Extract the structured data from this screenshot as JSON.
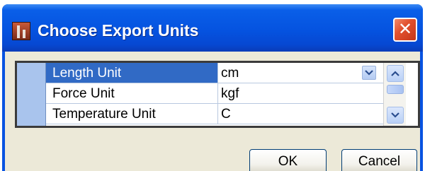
{
  "window": {
    "title": "Choose Export Units",
    "app_icon": "app-logo-icon",
    "close_icon": "close-icon",
    "close_symbol": "✕",
    "colors": {
      "titlebar": "#0553e0",
      "close": "#e2512e",
      "client": "#ece9d8",
      "selection": "#316ac5"
    }
  },
  "grid": {
    "rows": [
      {
        "name": "Length Unit",
        "value": "cm",
        "selected": true,
        "has_dropdown": true
      },
      {
        "name": "Force Unit",
        "value": "kgf",
        "selected": false,
        "has_dropdown": false
      },
      {
        "name": "Temperature Unit",
        "value": "C",
        "selected": false,
        "has_dropdown": false
      }
    ]
  },
  "buttons": {
    "ok_label": "OK",
    "cancel_label": "Cancel"
  }
}
